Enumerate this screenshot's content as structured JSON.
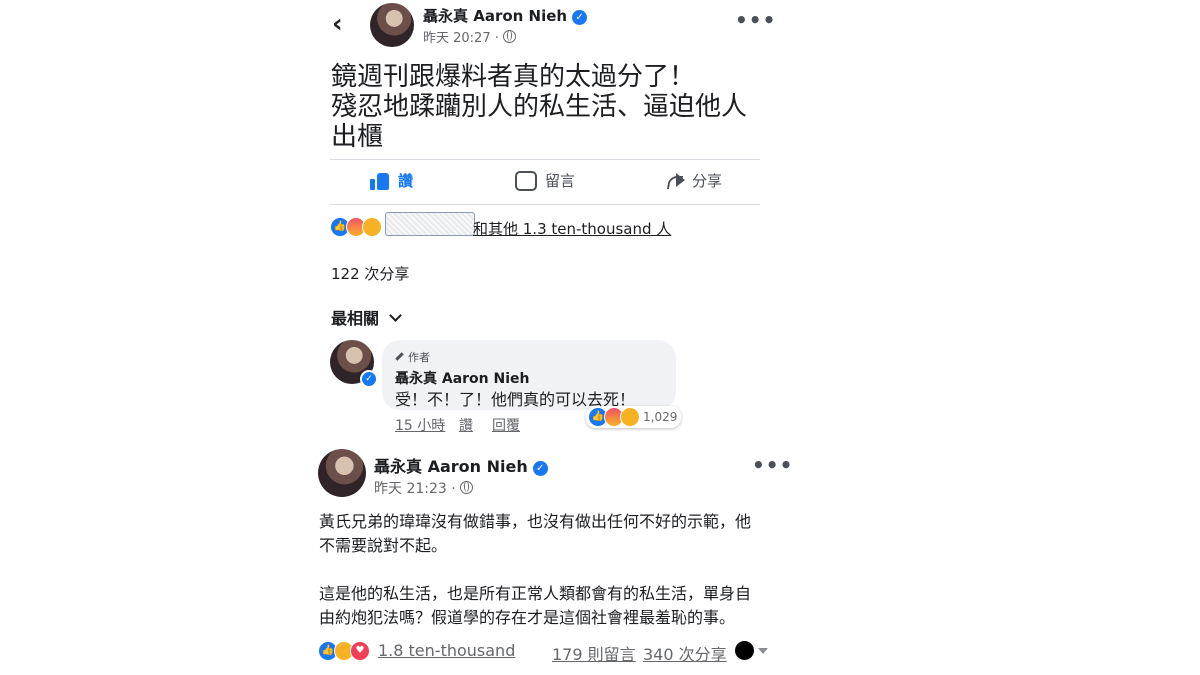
{
  "post1": {
    "author": "聶永真 Aaron Nieh",
    "verified_icon": "✓",
    "time": "昨天 20:27 ·",
    "text": "鏡週刊跟爆料者真的太過分了！\n殘忍地蹂躪別人的私生活、逼迫他人\n出櫃",
    "actions": {
      "like": "讚",
      "comment": "留言",
      "share": "分享"
    },
    "reaction_summary": "和其他 1.3 ten-thousand 人",
    "shares": "122 次分享"
  },
  "comments": {
    "sort_label": "最相關",
    "author_badge": "作者",
    "name": "聶永真 Aaron Nieh",
    "text": "受！不！了！他們真的可以去死！",
    "time": "15 小時",
    "like": "讚",
    "reply": "回覆",
    "reaction_count": "1,029"
  },
  "post2": {
    "author": "聶永真 Aaron Nieh",
    "time": "昨天 21:23 ·",
    "text": "黃氏兄弟的瑋瑋沒有做錯事，也沒有做出任何不好的示範，他\n不需要說對不起。\n\n這是他的私生活，也是所有正常人類都會有的私生活，單身自\n由約炮犯法嗎？假道學的存在才是這個社會裡最羞恥的事。",
    "reaction_count": "1.8 ten-thousand",
    "comments": "179 則留言",
    "shares": "340 次分享"
  },
  "colors": {
    "brand_blue": "#1877f2",
    "text": "#1c1e21",
    "muted": "#65676b",
    "divider": "#dadde1"
  },
  "icons": [
    "back-arrow-icon",
    "verified-icon",
    "globe-icon",
    "more-icon",
    "like-icon",
    "comment-icon",
    "share-icon",
    "like-reaction-icon",
    "angry-reaction-icon",
    "sad-reaction-icon",
    "love-reaction-icon",
    "pencil-icon",
    "chevron-down-icon"
  ]
}
